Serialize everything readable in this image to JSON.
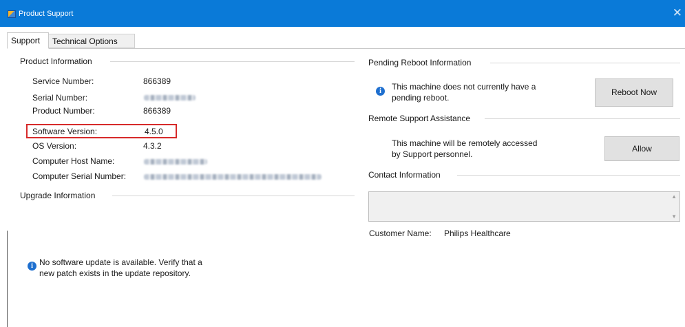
{
  "window": {
    "title": "Product Support",
    "close_glyph": "✕"
  },
  "tabs": [
    {
      "label": "Support",
      "active": true
    },
    {
      "label": "Technical Options",
      "active": false
    }
  ],
  "product_info": {
    "title": "Product Information",
    "fields": [
      {
        "label": "Service Number:",
        "value": "866389"
      },
      {
        "label": "Serial Number:",
        "value": "",
        "redacted": true
      },
      {
        "label": "Product Number:",
        "value": "866389"
      },
      {
        "label": "Software Version:",
        "value": "4.5.0",
        "highlighted": true
      },
      {
        "label": "OS Version:",
        "value": "4.3.2"
      },
      {
        "label": "Computer Host Name:",
        "value": "",
        "redacted": true
      },
      {
        "label": "Computer Serial Number:",
        "value": "",
        "redacted": true
      }
    ]
  },
  "upgrade_info": {
    "title": "Upgrade Information",
    "message_line1": "No software update is available. Verify that a",
    "message_line2": "new patch exists in the update repository."
  },
  "pending_reboot": {
    "title": "Pending Reboot Information",
    "message_line1": "This machine does not currently have a",
    "message_line2": "pending reboot.",
    "button_label": "Reboot Now"
  },
  "remote_support": {
    "title": "Remote Support Assistance",
    "message_line1": "This machine will be remotely accessed",
    "message_line2": "by Support personnel.",
    "button_label": "Allow"
  },
  "contact_info": {
    "title": "Contact Information",
    "text_value": "",
    "customer_label": "Customer Name:",
    "customer_value": "Philips Healthcare"
  },
  "colors": {
    "titlebar": "#0a7ad8",
    "highlight": "#d72a2a",
    "info_icon": "#1e6fcf"
  },
  "icons": {
    "info": "info-icon",
    "app": "app-icon"
  }
}
